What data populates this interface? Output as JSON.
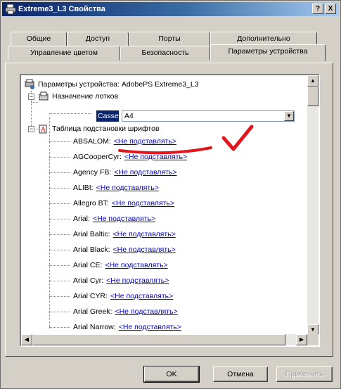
{
  "window": {
    "title": "Extreme3_L3 Свойства",
    "help_button": "?",
    "close_button": "X"
  },
  "tabs": {
    "row_back": [
      {
        "label": "Общие"
      },
      {
        "label": "Доступ"
      },
      {
        "label": "Порты"
      },
      {
        "label": "Дополнительно"
      }
    ],
    "row_front": [
      {
        "label": "Управление цветом"
      },
      {
        "label": "Безопасность"
      },
      {
        "label": "Параметры устройства",
        "active": true
      }
    ]
  },
  "tree": {
    "root_label": "Параметры устройства: AdobePS Extreme3_L3",
    "paper_section": "Назначение лотков",
    "cassette_label": "Cassette:",
    "cassette_value": "A4",
    "font_section": "Таблица подстановки шрифтов",
    "fonts": [
      {
        "name": "ABSALOM:",
        "value": "<Не подставлять>"
      },
      {
        "name": "AGCooperCyr:",
        "value": "<Не подставлять>"
      },
      {
        "name": "Agency FB:",
        "value": "<Не подставлять>"
      },
      {
        "name": "ALIBI:",
        "value": "<Не подставлять>"
      },
      {
        "name": "Allegro BT:",
        "value": "<Не подставлять>"
      },
      {
        "name": "Arial:",
        "value": "<Не подставлять>"
      },
      {
        "name": "Arial Baltic:",
        "value": "<Не подставлять>"
      },
      {
        "name": "Arial Black:",
        "value": "<Не подставлять>"
      },
      {
        "name": "Arial CE:",
        "value": "<Не подставлять>"
      },
      {
        "name": "Arial Cyr:",
        "value": "<Не подставлять>"
      },
      {
        "name": "Arial CYR:",
        "value": "<Не подставлять>"
      },
      {
        "name": "Arial Greek:",
        "value": "<Не подставлять>"
      },
      {
        "name": "Arial Narrow:",
        "value": "<Не подставлять>"
      }
    ]
  },
  "buttons": {
    "ok": "OK",
    "cancel": "Отмена",
    "apply": "Применить"
  },
  "colors": {
    "annotation": "#e0181e",
    "link": "#0000cc",
    "titlebar": "#0a246a"
  }
}
